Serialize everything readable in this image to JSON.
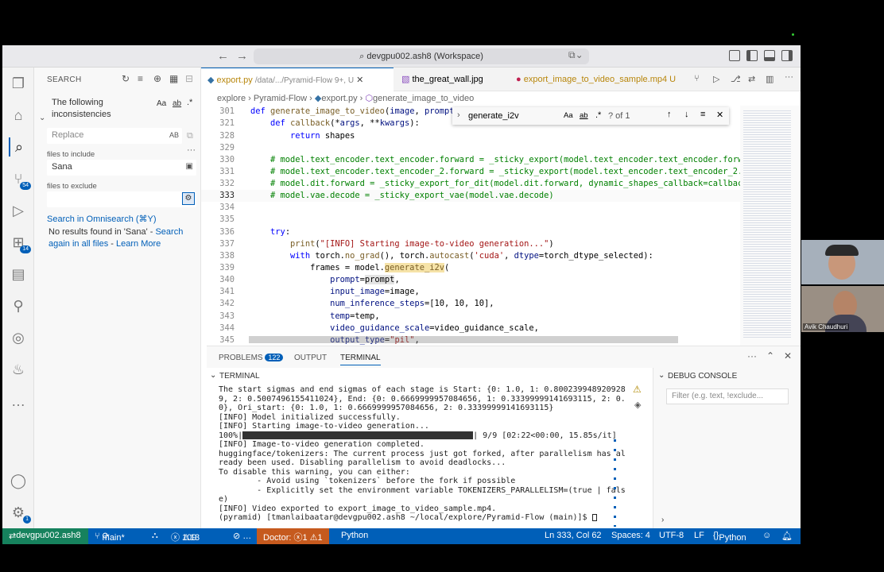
{
  "titlebar": {
    "workspace": "devgpu002.ash8 (Workspace)"
  },
  "sidebar": {
    "title": "SEARCH",
    "search_value": "The following inconsistencies",
    "replace_placeholder": "Replace",
    "files_include_label": "files to include",
    "files_include_value": "Sana",
    "files_exclude_label": "files to exclude",
    "omnisearch_link": "Search in Omnisearch (⌘Y)",
    "no_results": "No results found in 'Sana' - ",
    "search_again": "Search again in all files",
    "learn_more": "Learn More",
    "aa": "Aa",
    "ab": "AB"
  },
  "activity": {
    "scm_badge": "54",
    "ext_badge": "14",
    "accounts_badge": "1"
  },
  "tabs": [
    {
      "label": "export.py",
      "path": "/data/.../Pyramid-Flow 9+, U"
    },
    {
      "label": "the_great_wall.jpg"
    },
    {
      "label": "export_image_to_video_sample.mp4",
      "badge": "U"
    }
  ],
  "breadcrumb": [
    "explore",
    "Pyramid-Flow",
    "export.py",
    "generate_image_to_video"
  ],
  "find": {
    "value": "generate_i2v",
    "count": "? of 1"
  },
  "code": [
    {
      "n": "301",
      "t": "def generate_image_to_video(image, prompt,"
    },
    {
      "n": "321",
      "t": "    def callback(*args, **kwargs):"
    },
    {
      "n": "328",
      "t": "        return shapes"
    },
    {
      "n": "329",
      "t": ""
    },
    {
      "n": "330",
      "t": "    # model.text_encoder.text_encoder.forward = _sticky_export(model.text_encoder.text_encoder.forward"
    },
    {
      "n": "331",
      "t": "    # model.text_encoder.text_encoder_2.forward = _sticky_export(model.text_encoder.text_encoder_2.for"
    },
    {
      "n": "332",
      "t": "    # model.dit.forward = _sticky_export_for_dit(model.dit.forward, dynamic_shapes_callback=callback)"
    },
    {
      "n": "333",
      "t": "    # model.vae.decode = _sticky_export_vae(model.vae.decode)"
    },
    {
      "n": "334",
      "t": ""
    },
    {
      "n": "335",
      "t": ""
    },
    {
      "n": "336",
      "t": "    try:"
    },
    {
      "n": "337",
      "t": "        print(\"[INFO] Starting image-to-video generation...\")"
    },
    {
      "n": "338",
      "t": "        with torch.no_grad(), torch.autocast('cuda', dtype=torch_dtype_selected):"
    },
    {
      "n": "339",
      "t": "            frames = model.generate_i2v("
    },
    {
      "n": "340",
      "t": "                prompt=prompt,"
    },
    {
      "n": "341",
      "t": "                input_image=image,"
    },
    {
      "n": "342",
      "t": "                num_inference_steps=[10, 10, 10],"
    },
    {
      "n": "343",
      "t": "                temp=temp,"
    },
    {
      "n": "344",
      "t": "                video_guidance_scale=video_guidance_scale,"
    },
    {
      "n": "345",
      "t": "                output_type=\"pil\","
    }
  ],
  "panel": {
    "problems": "PROBLEMS",
    "problems_count": "122",
    "output": "OUTPUT",
    "terminal": "TERMINAL",
    "terminal_header": "TERMINAL",
    "debug_header": "DEBUG CONSOLE",
    "debug_filter": "Filter (e.g. text, !exclude..."
  },
  "terminal_lines": [
    "The start sigmas and end sigmas of each stage is Start: {0: 1.0, 1: 0.800239948920928",
    "9, 2: 0.5007496155411024}, End: {0: 0.6669999957084656, 1: 0.33399999141693115, 2: 0.",
    "0}, Ori_start: {0: 1.0, 1: 0.6669999957084656, 2: 0.33399999141693115}",
    "[INFO] Model initialized successfully.",
    "[INFO] Starting image-to-video generation...",
    "100%|",
    "[INFO] Image-to-video generation completed.",
    "huggingface/tokenizers: The current process just got forked, after parallelism has al",
    "ready been used. Disabling parallelism to avoid deadlocks...",
    "To disable this warning, you can either:",
    "        - Avoid using `tokenizers` before the fork if possible",
    "        - Explicitly set the environment variable TOKENIZERS_PARALLELISM=(true | fals",
    "e)",
    "[INFO] Video exported to export_image_to_video_sample.mp4.",
    "(pyramid) [tmanlaibaatar@devgpu002.ash8 ~/local/explore/Pyramid-Flow (main)]$ "
  ],
  "progress": {
    "fraction": 1.0,
    "label": "| 9/9 [02:22<00:00, 15.85s/it]"
  },
  "status": {
    "remote": "devgpu002.ash8",
    "branch": "main*",
    "errors": "109",
    "warnings": "13",
    "doctor": "Doctor: ⓧ1 ⚠1",
    "lang_left": "Python",
    "position": "Ln 333, Col 62",
    "spaces": "Spaces: 4",
    "encoding": "UTF-8",
    "eol": "LF",
    "language": "Python"
  },
  "video": {
    "participant": "Avik Chaudhuri"
  }
}
